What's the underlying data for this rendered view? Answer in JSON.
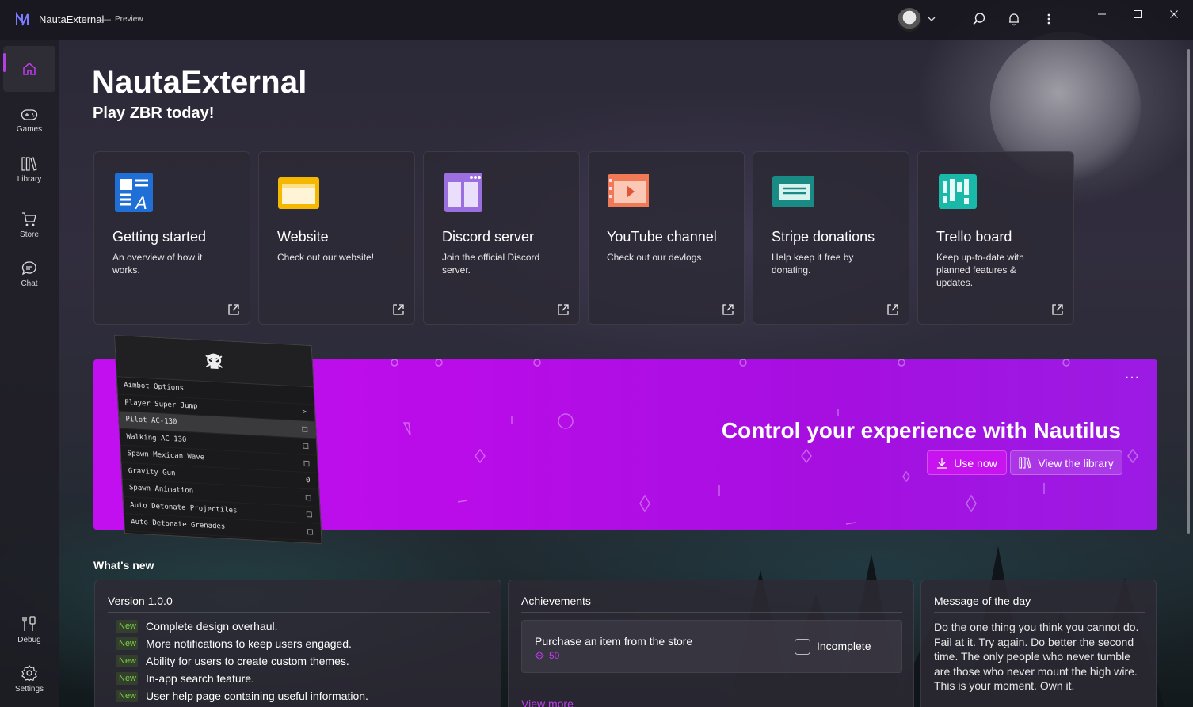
{
  "titlebar": {
    "app_name": "NautaExternal",
    "separator": "—",
    "badge": "Preview",
    "icons": [
      "app-logo-icon",
      "avatar",
      "chevron-down-icon",
      "search-icon",
      "bell-icon",
      "more-vertical-icon",
      "minimize-icon",
      "maximize-icon",
      "close-icon"
    ]
  },
  "nav": {
    "items": [
      {
        "id": "home",
        "label": "",
        "icon": "home-icon"
      },
      {
        "id": "games",
        "label": "Games",
        "icon": "gamepad-icon"
      },
      {
        "id": "library",
        "label": "Library",
        "icon": "library-icon"
      },
      {
        "id": "store",
        "label": "Store",
        "icon": "cart-icon"
      },
      {
        "id": "chat",
        "label": "Chat",
        "icon": "chat-icon"
      },
      {
        "id": "debug",
        "label": "Debug",
        "icon": "tools-icon"
      },
      {
        "id": "settings",
        "label": "Settings",
        "icon": "gear-icon"
      }
    ]
  },
  "hero": {
    "title": "NautaExternal",
    "subtitle": "Play ZBR today!"
  },
  "cards": [
    {
      "title": "Getting started",
      "desc": "An overview of how it works.",
      "icon": "getting-started-icon"
    },
    {
      "title": "Website",
      "desc": "Check out our website!",
      "icon": "folder-icon"
    },
    {
      "title": "Discord server",
      "desc": "Join the official Discord server.",
      "icon": "discord-window-icon"
    },
    {
      "title": "YouTube channel",
      "desc": "Check out our devlogs.",
      "icon": "video-icon"
    },
    {
      "title": "Stripe donations",
      "desc": "Help keep it free by donating.",
      "icon": "card-icon"
    },
    {
      "title": "Trello board",
      "desc": "Keep up-to-date with planned features & updates.",
      "icon": "board-icon"
    }
  ],
  "banner": {
    "title": "Control your experience with Nautilus",
    "more": "···",
    "primary_button": "Use now",
    "secondary_button": "View the library",
    "menu_rows": [
      {
        "label": "Aimbot Options",
        "suffix": ""
      },
      {
        "label": "Player Super Jump",
        "suffix": ">"
      },
      {
        "label": "Pilot AC-130",
        "suffix": "box"
      },
      {
        "label": "Walking AC-130",
        "suffix": "box"
      },
      {
        "label": "Spawn Mexican Wave",
        "suffix": "box"
      },
      {
        "label": "Gravity Gun",
        "suffix": "0"
      },
      {
        "label": "Spawn Animation",
        "suffix": "box"
      },
      {
        "label": "Auto Detonate Projectiles",
        "suffix": "box"
      },
      {
        "label": "Auto Detonate Grenades",
        "suffix": "box"
      }
    ]
  },
  "whats_new": {
    "title": "What's new",
    "version": {
      "title": "Version 1.0.0",
      "tag": "New",
      "items": [
        "Complete design overhaul.",
        "More notifications to keep users engaged.",
        "Ability for users to create custom themes.",
        "In-app search feature.",
        "User help page containing useful information."
      ]
    },
    "achievements": {
      "title": "Achievements",
      "item_name": "Purchase an item from the store",
      "points": "50",
      "status": "Incomplete",
      "view_more": "View more"
    },
    "motd": {
      "title": "Message of the day",
      "text": "Do the one thing you think you cannot do. Fail at it. Try again. Do better the second time. The only people who never tumble are those who never mount the high wire. This is your moment. Own it."
    }
  },
  "colors": {
    "accent": "#c013ee",
    "tag_green": "#7ad04a"
  }
}
